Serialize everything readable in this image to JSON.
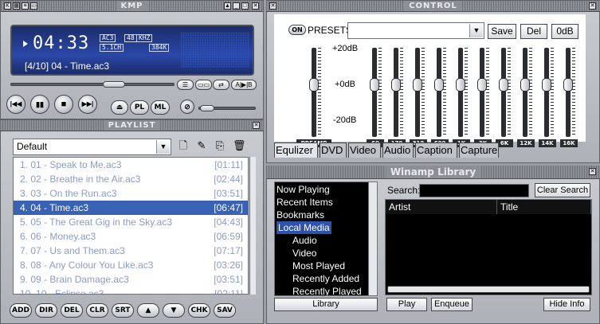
{
  "player": {
    "title": "KMP",
    "time": "04:33",
    "badges": {
      "codec": "AC3",
      "channels": "5.1CH",
      "bits": "48",
      "khz": "KHZ",
      "bitrate": "384K"
    },
    "track": "[4/10] 04 - Time.ac3",
    "seek_position": 0.42,
    "volume_level": 0.25,
    "small_buttons": [
      "☰",
      "▭▭",
      "⇄",
      "A|▶|B"
    ],
    "control_buttons": [
      "|◀◀",
      "▮▮",
      "■",
      "▶▶|"
    ],
    "pill_buttons": {
      "eject": "⏏",
      "pl": "PL",
      "ml": "ML"
    }
  },
  "playlist": {
    "title": "PLAYLIST",
    "selected_list": "Default",
    "items": [
      {
        "name": "1. 01 - Speak to Me.ac3",
        "dur": "[01:11]",
        "selected": false
      },
      {
        "name": "2. 02 - Breathe in the Air.ac3",
        "dur": "[02:44]",
        "selected": false
      },
      {
        "name": "3. 03 - On the Run.ac3",
        "dur": "[03:51]",
        "selected": false
      },
      {
        "name": "4. 04 - Time.ac3",
        "dur": "[06:47]",
        "selected": true
      },
      {
        "name": "5. 05 - The Great Gig in the Sky.ac3",
        "dur": "[04:43]",
        "selected": false
      },
      {
        "name": "6. 06 - Money.ac3",
        "dur": "[06:59]",
        "selected": false
      },
      {
        "name": "7. 07 - Us and Them.ac3",
        "dur": "[07:17]",
        "selected": false
      },
      {
        "name": "8. 08 - Any Colour You Like.ac3",
        "dur": "[03:26]",
        "selected": false
      },
      {
        "name": "9. 09 - Brain Damage.ac3",
        "dur": "[03:51]",
        "selected": false
      },
      {
        "name": "10. 10 - Eclipse.ac3",
        "dur": "[02:11]",
        "selected": false
      }
    ],
    "bottom_buttons": [
      "ADD",
      "DIR",
      "DEL",
      "CLR",
      "SRT",
      "▲",
      "▼",
      "CHK",
      "SAV"
    ]
  },
  "control": {
    "title": "CONTROL",
    "on_label": "ON",
    "presets_label": "PRESETS",
    "preset_value": "",
    "buttons": {
      "save": "Save",
      "del": "Del",
      "zero": "0dB"
    },
    "db_labels": {
      "top": "+20dB",
      "mid": "+0dB",
      "bottom": "-20dB"
    },
    "preamp_label": "PREAMP",
    "bands": [
      "60",
      "170",
      "310",
      "600",
      "1K",
      "3K",
      "6K",
      "12K",
      "14K",
      "16K"
    ],
    "tabs": [
      "Equlizer",
      "DVD",
      "Video",
      "Audio",
      "Caption",
      "Capture"
    ]
  },
  "library": {
    "title": "Winamp Library",
    "tree": [
      "Now Playing",
      "Recent Items",
      "Bookmarks",
      "Local Media",
      "Audio",
      "Video",
      "Most Played",
      "Recently Added",
      "Recently Played"
    ],
    "search_label": "Search:",
    "search_value": "",
    "clear_search": "Clear Search",
    "columns": [
      "Artist",
      "Title"
    ],
    "buttons": {
      "library": "Library",
      "play": "Play",
      "enqueue": "Enqueue",
      "hide_info": "Hide Info"
    }
  }
}
